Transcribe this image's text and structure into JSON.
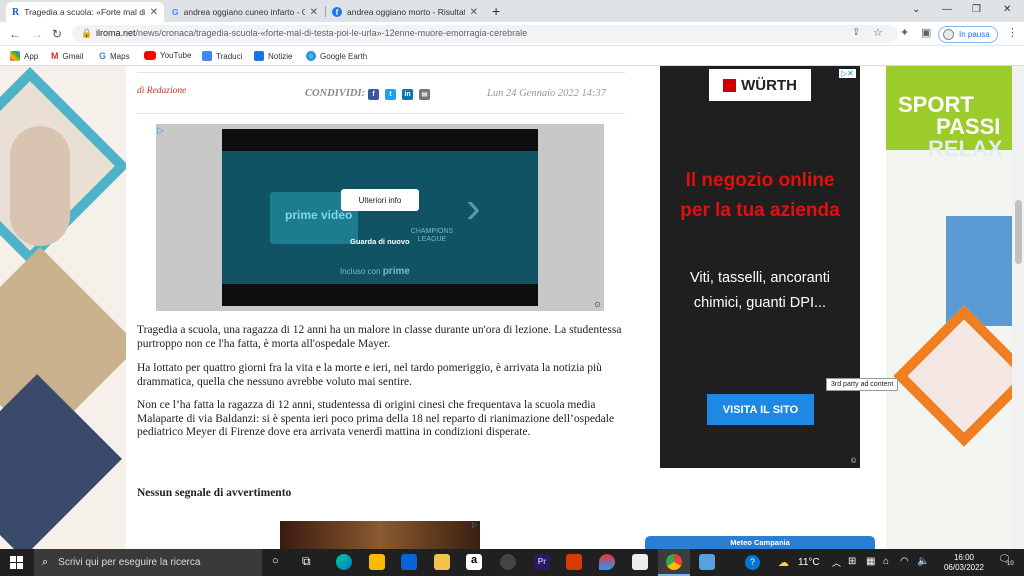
{
  "browser": {
    "tabs": [
      {
        "title": "Tragedia a scuola: «Forte mal di t",
        "icon": "R"
      },
      {
        "title": "andrea oggiano cuneo infarto - G",
        "icon": "G"
      },
      {
        "title": "andrea oggiano morto - Risultati",
        "icon": "f"
      }
    ],
    "new_tab": "+",
    "url_host": "ilroma.net",
    "url_path": "/news/cronaca/tragedia-scuola-«forte-mal-di-testa-poi-le-urla»-12enne-muore-emorragia-cerebrale",
    "pause_label": "In pausa"
  },
  "bookmarks": [
    {
      "label": "App",
      "color": "#e8453c"
    },
    {
      "label": "Gmail",
      "color": "#d93025"
    },
    {
      "label": "Maps",
      "color": "#34a853"
    },
    {
      "label": "YouTube",
      "color": "#ff0000"
    },
    {
      "label": "Traduci",
      "color": "#4285f4"
    },
    {
      "label": "Notizie",
      "color": "#1a73e8"
    },
    {
      "label": "Google Earth",
      "color": "#4285f4"
    }
  ],
  "article": {
    "author_prefix": "di",
    "author": "Redazione",
    "share_label": "CONDIVIDI:",
    "date": "Lun 24 Gennaio 2022 14:37",
    "video": {
      "more_info": "Ulteriori info",
      "replay": "Guarda di nuovo",
      "brand": "prime video",
      "league": "CHAMPIONS LEAGUE",
      "included": "Incluso con",
      "prime": "prime"
    },
    "paragraphs": [
      "Tragedia a scuola, una ragazza di 12 anni ha un malore in classe durante un'ora di lezione. La studentessa purtroppo non ce l'ha fatta, è morta all'ospedale Mayer.",
      "Ha lottato per quattro giorni fra la vita e la morte e ieri, nel tardo pomeriggio, è arrivata la notizia più drammatica, quella che nessuno avrebbe voluto mai sentire.",
      "Non ce l’ha fatta la ragazza di 12 anni, studentessa di origini cinesi che frequentava la scuola media Malaparte di via Baldanzi: si è spenta ieri poco prima della 18 nel reparto di rianimazione dell’ospedale pediatrico Meyer di Firenze dove era arrivata venerdì mattina in condizioni disperate."
    ],
    "subheading": "Nessun segnale di avvertimento"
  },
  "ads": {
    "wurth_logo": "WÜRTH",
    "wurth_headline": "Il negozio online per la tua azienda",
    "wurth_body": "Viti, tasselli, ancoranti chimici, guanti DPI...",
    "wurth_cta": "VISITA IL SITO",
    "tooltip": "3rd party ad content",
    "right_banner_line1": "SPORT",
    "right_banner_line2": "PASSI",
    "right_banner_line3": "RELAX",
    "meteo": "Meteo Campania"
  },
  "taskbar": {
    "search_placeholder": "Scrivi qui per eseguire la ricerca",
    "weather": "11°C",
    "time": "16:00",
    "date": "06/03/2022",
    "notifications": "10"
  }
}
